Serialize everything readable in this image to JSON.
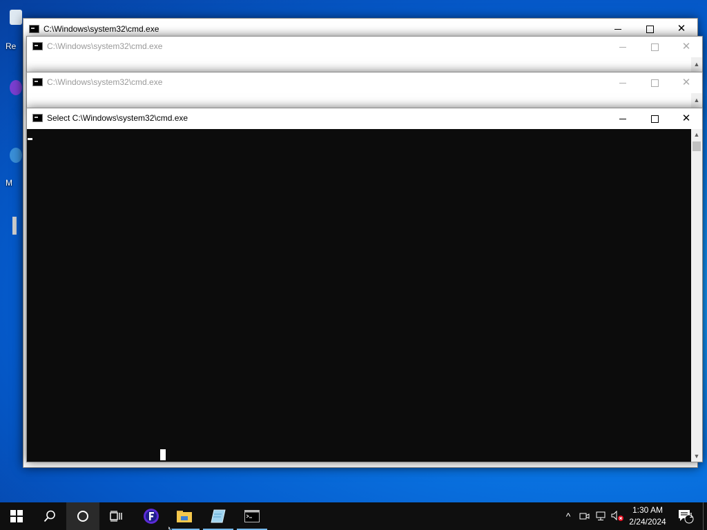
{
  "desktop": {
    "icons": [
      {
        "label": "Re",
        "color": "#dfe9f2"
      },
      {
        "label": "",
        "color": "#7a3fd1"
      },
      {
        "label": "M",
        "color": "#3a8fd8"
      }
    ]
  },
  "windows": {
    "back": {
      "title": "C:\\Windows\\system32\\cmd.exe"
    },
    "second": {
      "title": "C:\\Windows\\system32\\cmd.exe"
    },
    "third": {
      "title": "C:\\Windows\\system32\\cmd.exe"
    },
    "front": {
      "title": "Select C:\\Windows\\system32\\cmd.exe"
    }
  },
  "controls": {
    "minimize": "—",
    "close": "✕"
  },
  "scroll": {
    "up": "▲",
    "down": "▼"
  },
  "taskbar": {
    "icons": [
      "windows-start-icon",
      "search-icon",
      "cortana-icon",
      "task-view-icon",
      "app-f-icon",
      "file-explorer-icon",
      "notepad-icon",
      "cmd-icon"
    ],
    "tray": {
      "chevron": "^",
      "notification_count": "1"
    },
    "clock": {
      "time": "1:30 AM",
      "date": "2/24/2024"
    }
  },
  "colors": {
    "accent": "#76b9ed",
    "console_bg": "#0c0c0c",
    "taskbar_bg": "#0f0f0f"
  }
}
